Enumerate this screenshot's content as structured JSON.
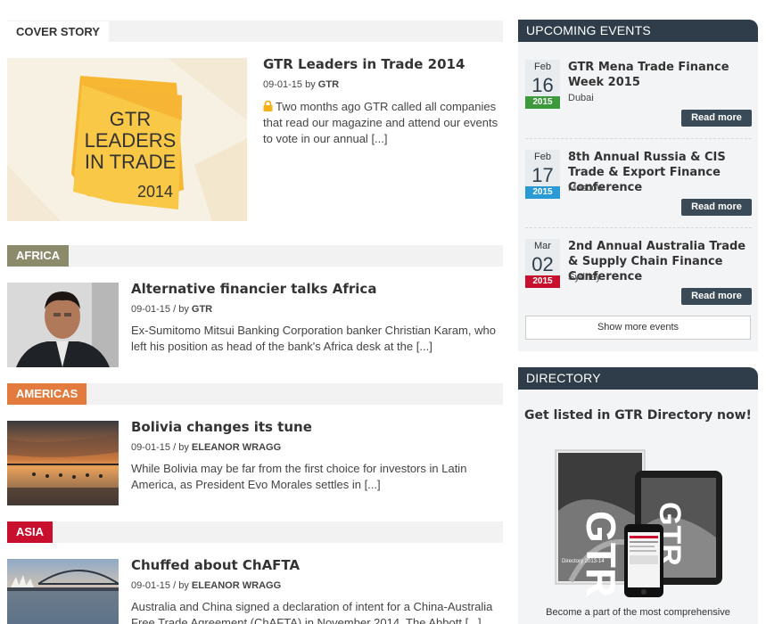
{
  "cover": {
    "section_label": "COVER STORY",
    "headline": "GTR Leaders in Trade 2014",
    "date": "09-01-15",
    "by": "by",
    "author": "GTR",
    "excerpt": "Two months ago GTR called all companies that read our magazine and attend our events to vote in our annual",
    "more": "[...]",
    "image_text": [
      "GTR",
      "LEADERS",
      "IN TRADE",
      "2014"
    ]
  },
  "africa": {
    "section_label": "AFRICA",
    "color": "#8b8a6b",
    "headline": "Alternative financier talks Africa",
    "date": "09-01-15",
    "by": "/ by",
    "author": "GTR",
    "excerpt": "Ex-Sumitomo Mitsui Banking Corporation banker Christian Karam, who left his position as head of the bank's Africa desk at the",
    "more": "[...]"
  },
  "americas": {
    "section_label": "AMERICAS",
    "color": "#e37b3e",
    "headline": "Bolivia changes its tune",
    "date": "09-01-15",
    "by": "/ by",
    "author": "ELEANOR WRAGG",
    "excerpt": "While Bolivia may be far from the first choice for investors in Latin America, as President Evo Morales settles in",
    "more": "[...]"
  },
  "asia": {
    "section_label": "ASIA",
    "color": "#c8102e",
    "headline": "Chuffed about ChAFTA",
    "date": "09-01-15",
    "by": "/ by",
    "author": "ELEANOR WRAGG",
    "excerpt": "Australia and China signed a declaration of intent for a China-Australia Free Trade Agreement (ChAFTA) in November 2014. The Abbott",
    "more": "[...]"
  },
  "events": {
    "title": "UPCOMING EVENTS",
    "items": [
      {
        "month": "Feb",
        "day": "16",
        "year": "2015",
        "year_color": "#3c9a3c",
        "title": "GTR Mena Trade Finance Week 2015",
        "city": "Dubai",
        "button": "Read more"
      },
      {
        "month": "Feb",
        "day": "17",
        "year": "2015",
        "year_color": "#2a9ad6",
        "title": "8th Annual Russia & CIS Trade & Export Finance Conference",
        "city": "Moscow",
        "button": "Read more"
      },
      {
        "month": "Mar",
        "day": "02",
        "year": "2015",
        "year_color": "#c8102e",
        "title": "2nd Annual Australia Trade & Supply Chain Finance Conference",
        "city": "Sydney",
        "button": "Read more"
      }
    ],
    "show_more": "Show more events"
  },
  "directory": {
    "title": "DIRECTORY",
    "heading": "Get listed in GTR Directory now!",
    "footer": "Become a part of the most comprehensive",
    "cover_text": "GTR",
    "cover_sub": "Directory 2013-14"
  }
}
